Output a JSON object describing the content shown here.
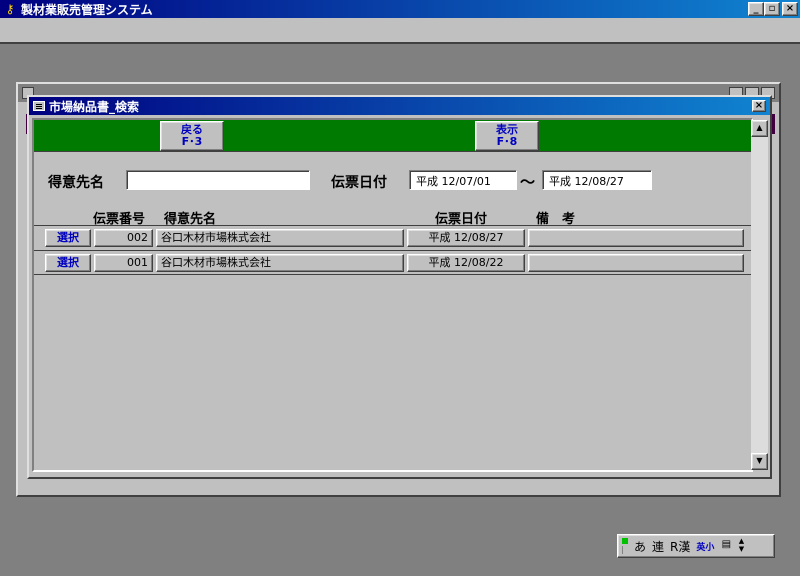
{
  "app": {
    "title": "製材業販売管理システム",
    "buttons": {
      "minimize": "_",
      "maximize": "▫",
      "close": "×"
    }
  },
  "dialog": {
    "title": "市場納品書_検索",
    "close": "×",
    "toolbar": {
      "back": {
        "label": "戻る",
        "key": "F･3"
      },
      "show": {
        "label": "表示",
        "key": "F･8"
      }
    },
    "filters": {
      "customer_label": "得意先名",
      "customer_value": "",
      "date_label": "伝票日付",
      "date_from": "平成 12/07/01",
      "tilde": "～",
      "date_to": "平成 12/08/27"
    },
    "columns": {
      "no": "伝票番号",
      "customer": "得意先名",
      "date": "伝票日付",
      "remarks": "備　考"
    },
    "rows": [
      {
        "select": "選択",
        "no": "002",
        "customer": "谷口木材市場株式会社",
        "date": "平成 12/08/27",
        "remarks": ""
      },
      {
        "select": "選択",
        "no": "001",
        "customer": "谷口木材市場株式会社",
        "date": "平成 12/08/22",
        "remarks": ""
      }
    ],
    "scroll": {
      "up": "▲",
      "down": "▼"
    }
  },
  "ime": {
    "mode1": "あ",
    "mode2": "連",
    "mode3": "R漢",
    "mode4": "英小",
    "pad": "▤",
    "up": "▲",
    "down": "▼"
  }
}
